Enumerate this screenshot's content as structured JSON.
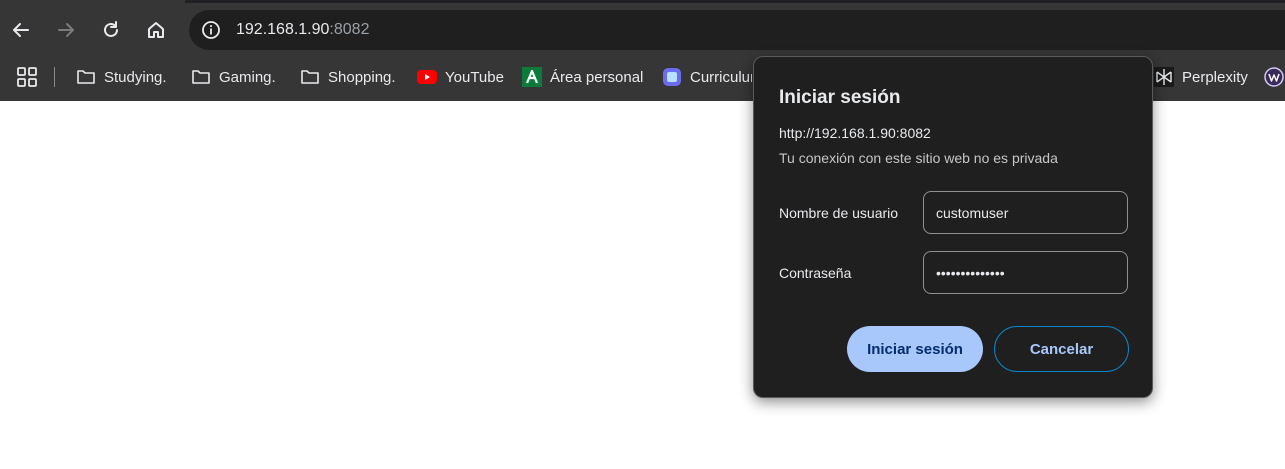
{
  "browser": {
    "address_bar": {
      "host": "192.168.1.90",
      "port": ":8082"
    },
    "bookmarks": [
      {
        "label": "Studying.",
        "icon": "folder-icon"
      },
      {
        "label": "Gaming.",
        "icon": "folder-icon"
      },
      {
        "label": "Shopping.",
        "icon": "folder-icon"
      },
      {
        "label": "YouTube",
        "icon": "youtube-icon"
      },
      {
        "label": "Área personal",
        "icon": "area-personal-icon"
      },
      {
        "label": "Curriculum",
        "icon": "curriculum-icon"
      },
      {
        "label": "Perplexity",
        "icon": "perplexity-icon"
      }
    ],
    "bookmark_trailing_icon": "wordpress-icon"
  },
  "dialog": {
    "title": "Iniciar sesión",
    "url": "http://192.168.1.90:8082",
    "warning": "Tu conexión con este sitio web no es privada",
    "username_label": "Nombre de usuario",
    "username_value": "customuser",
    "password_label": "Contraseña",
    "password_value": "customuser1234",
    "submit_label": "Iniciar sesión",
    "cancel_label": "Cancelar"
  },
  "colors": {
    "toolbar": "#363636",
    "omnibox": "#1f1f1f",
    "dialog_bg": "#1f1f1f",
    "primary_button": "#a8c7fa",
    "cancel_border": "#0b84c9"
  }
}
